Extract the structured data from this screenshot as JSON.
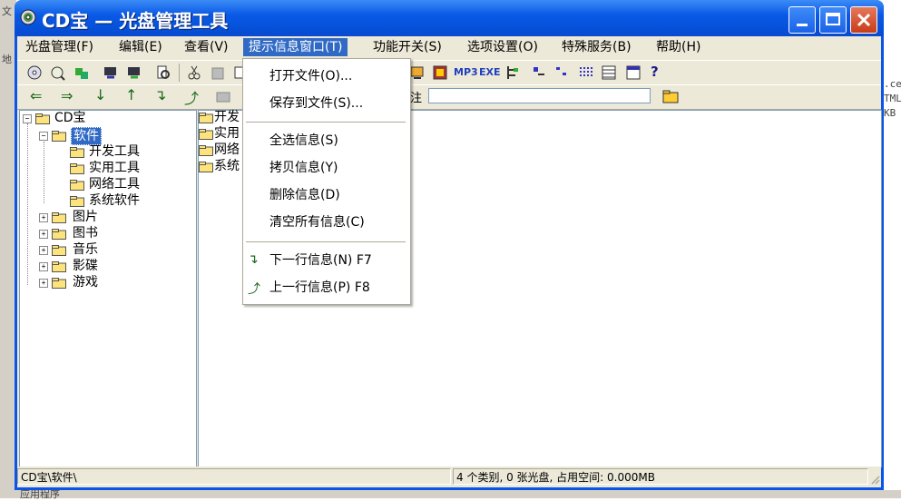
{
  "window": {
    "title": "CD宝 — 光盘管理工具"
  },
  "menubar": [
    {
      "label": "光盘管理(F)"
    },
    {
      "label": "编辑(E)"
    },
    {
      "label": "查看(V)"
    },
    {
      "label": "提示信息窗口(T)"
    },
    {
      "label": "功能开关(S)"
    },
    {
      "label": "选项设置(O)"
    },
    {
      "label": "特殊服务(B)"
    },
    {
      "label": "帮助(H)"
    }
  ],
  "dropdown": {
    "items": [
      {
        "label": "打开文件(O)..."
      },
      {
        "label": "保存到文件(S)..."
      },
      {
        "label": "全选信息(S)"
      },
      {
        "label": "拷贝信息(Y)"
      },
      {
        "label": "删除信息(D)"
      },
      {
        "label": "清空所有信息(C)"
      },
      {
        "label": "下一行信息(N)  F7"
      },
      {
        "label": "上一行信息(P)  F8"
      }
    ]
  },
  "toolbar": {
    "remark_label": "注",
    "remark_value": "",
    "mp3_label": "MP3",
    "exe_label": "EXE"
  },
  "tree": {
    "root": "CD宝",
    "software": "软件",
    "software_children": [
      "开发工具",
      "实用工具",
      "网络工具",
      "系统软件"
    ],
    "others": [
      "图片",
      "图书",
      "音乐",
      "影碟",
      "游戏"
    ]
  },
  "list": [
    "开发",
    "实用",
    "网络",
    "系统"
  ],
  "status": {
    "path": "CD宝\\软件\\",
    "summary": "4 个类别, 0 张光盘, 占用空间: 0.000MB"
  },
  "background": {
    "left_text": [
      "文",
      "地"
    ],
    "right_text": [
      ".ce",
      "TML",
      "KB"
    ],
    "bottom_text": "应用程序"
  },
  "colors": {
    "titlebar": "#0a55e6",
    "menu_highlight": "#316ac5",
    "face": "#ece9d8"
  }
}
